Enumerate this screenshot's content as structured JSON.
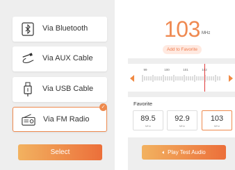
{
  "connection": {
    "options": [
      {
        "label": "Via Bluetooth",
        "icon": "bluetooth-icon"
      },
      {
        "label": "Via AUX Cable",
        "icon": "aux-cable-icon"
      },
      {
        "label": "Via USB Cable",
        "icon": "usb-cable-icon"
      },
      {
        "label": "Via FM Radio",
        "icon": "fm-radio-icon",
        "selected": true
      }
    ],
    "select_label": "Select"
  },
  "radio": {
    "frequency": "103",
    "unit": "MHz",
    "add_favorite_label": "Add to Favorite",
    "tuner_labels": [
      "99",
      "100",
      "101",
      "102"
    ],
    "favorite_title": "Favorite",
    "favorites": [
      {
        "value": "89.5",
        "unit": "MHz"
      },
      {
        "value": "92.9",
        "unit": "MHz"
      },
      {
        "value": "103",
        "unit": "MHz",
        "active": true
      }
    ],
    "play_label": "Play Test Audio"
  },
  "colors": {
    "accent": "#ef8a52",
    "needle": "#e03a3a",
    "panel_bg": "#eeeeee"
  }
}
